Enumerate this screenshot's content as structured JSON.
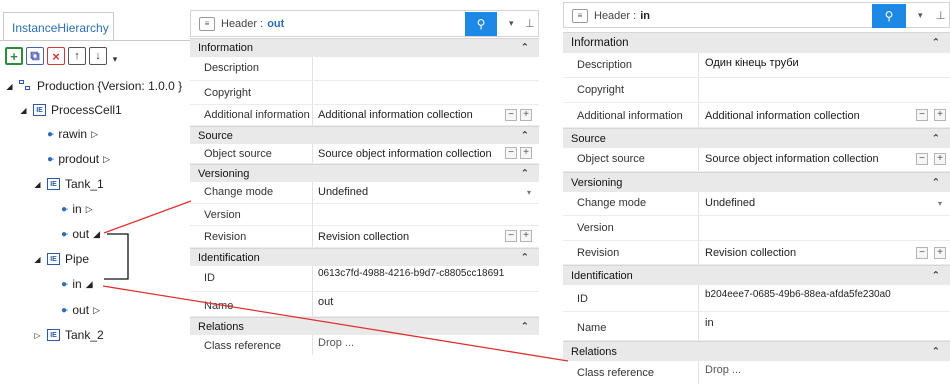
{
  "tree": {
    "tab_label": "InstanceHierarchy",
    "toolbar": {
      "add": "+",
      "duplicate": "⧉",
      "delete": "×",
      "up": "↑",
      "down": "↓",
      "more": "▾"
    },
    "nodes": [
      {
        "label": "Production",
        "suffix": "{Version: 1.0.0 }"
      },
      {
        "label": "ProcessCell1"
      },
      {
        "label": "rawin"
      },
      {
        "label": "prodout"
      },
      {
        "label": "Tank_1"
      },
      {
        "label": "in"
      },
      {
        "label": "out"
      },
      {
        "label": "Pipe"
      },
      {
        "label": "in"
      },
      {
        "label": "out"
      },
      {
        "label": "Tank_2"
      }
    ]
  },
  "left_panel": {
    "header_prefix": "Header :",
    "header_name": "out",
    "sections": {
      "information": "Information",
      "source": "Source",
      "versioning": "Versioning",
      "identification": "Identification",
      "relations": "Relations"
    },
    "rows": {
      "description": {
        "label": "Description",
        "value": ""
      },
      "copyright": {
        "label": "Copyright",
        "value": ""
      },
      "additional": {
        "label": "Additional information",
        "value": "Additional information collection"
      },
      "object_source": {
        "label": "Object source",
        "value": "Source object information collection"
      },
      "change_mode": {
        "label": "Change mode",
        "value": "Undefined"
      },
      "version": {
        "label": "Version",
        "value": ""
      },
      "revision": {
        "label": "Revision",
        "value": "Revision collection"
      },
      "id": {
        "label": "ID",
        "value": "0613c7fd-4988-4216-b9d7-c8805cc18691"
      },
      "name": {
        "label": "Name",
        "value": "out"
      },
      "class_reference": {
        "label": "Class reference",
        "value": "Drop ..."
      }
    }
  },
  "right_panel": {
    "header_prefix": "Header :",
    "header_name": "in",
    "sections": {
      "information": "Information",
      "source": "Source",
      "versioning": "Versioning",
      "identification": "Identification",
      "relations": "Relations"
    },
    "rows": {
      "description": {
        "label": "Description",
        "value": "Один кінець труби"
      },
      "copyright": {
        "label": "Copyright",
        "value": ""
      },
      "additional": {
        "label": "Additional information",
        "value": "Additional information collection"
      },
      "object_source": {
        "label": "Object source",
        "value": "Source object information collection"
      },
      "change_mode": {
        "label": "Change mode",
        "value": "Undefined"
      },
      "version": {
        "label": "Version",
        "value": ""
      },
      "revision": {
        "label": "Revision",
        "value": "Revision collection"
      },
      "id": {
        "label": "ID",
        "value": "b204eee7-0685-49b6-88ea-afda5fe230a0"
      },
      "name": {
        "label": "Name",
        "value": "in"
      },
      "class_reference": {
        "label": "Class reference",
        "value": "Drop ..."
      }
    }
  },
  "glyphs": {
    "chevron_up": "⌃",
    "pin": "⚲",
    "caret": "▾",
    "pushpin": "⊥",
    "minus": "−",
    "plus": "+"
  },
  "colors": {
    "accent": "#1e88e5",
    "link_line": "#e03030",
    "add_green": "#2e8b3a",
    "delete_red": "#d23a3a"
  }
}
